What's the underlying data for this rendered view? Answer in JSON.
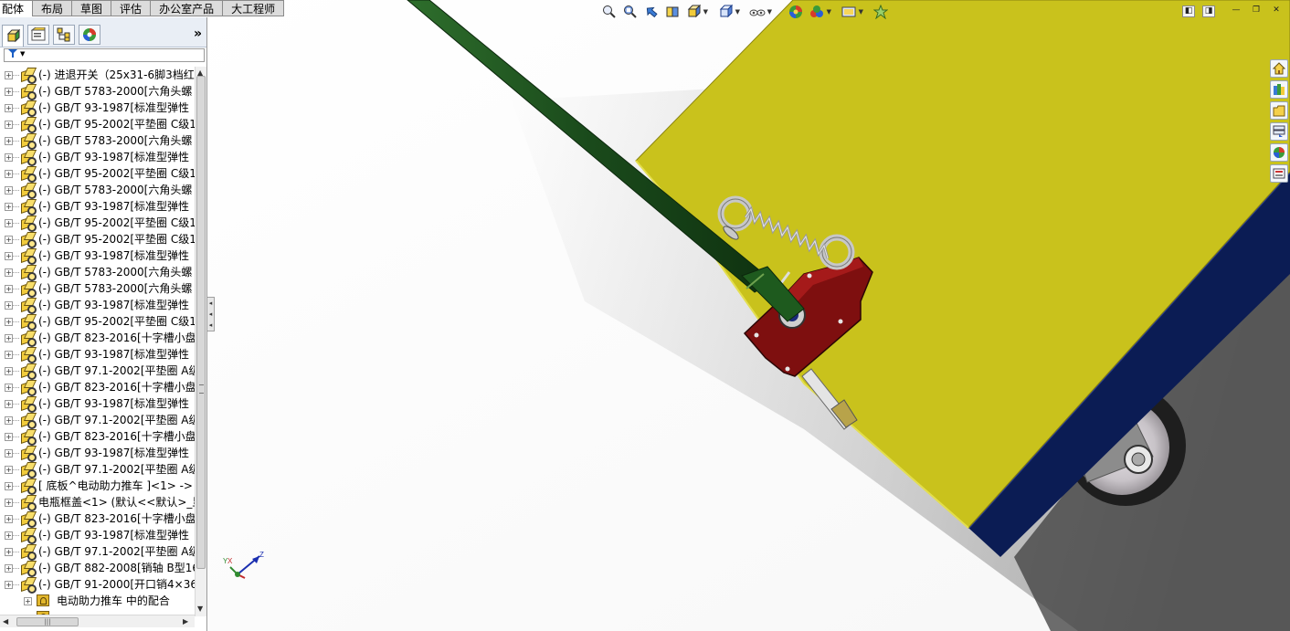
{
  "command_tabs": [
    {
      "label": "配体",
      "active": true
    },
    {
      "label": "布局",
      "active": false
    },
    {
      "label": "草图",
      "active": false
    },
    {
      "label": "评估",
      "active": false
    },
    {
      "label": "办公室产品",
      "active": false
    },
    {
      "label": "大工程师",
      "active": false
    }
  ],
  "panel": {
    "tabs": [
      "feature-manager-icon",
      "property-manager-icon",
      "configuration-manager-icon",
      "display-manager-icon"
    ],
    "expand_glyph": "»",
    "filter_glyph": "▼"
  },
  "tree": {
    "items": [
      "(-) 进退开关（25x31-6脚3档红",
      "(-) GB/T 5783-2000[六角头螺",
      "(-) GB/T 93-1987[标准型弹性",
      "(-) GB/T 95-2002[平垫圈 C级1",
      "(-) GB/T 5783-2000[六角头螺",
      "(-) GB/T 93-1987[标准型弹性",
      "(-) GB/T 95-2002[平垫圈 C级1",
      "(-) GB/T 5783-2000[六角头螺",
      "(-) GB/T 93-1987[标准型弹性",
      "(-) GB/T 95-2002[平垫圈 C级1",
      "(-) GB/T 95-2002[平垫圈 C级1",
      "(-) GB/T 93-1987[标准型弹性",
      "(-) GB/T 5783-2000[六角头螺",
      "(-) GB/T 5783-2000[六角头螺",
      "(-) GB/T 93-1987[标准型弹性",
      "(-) GB/T 95-2002[平垫圈 C级1",
      "(-) GB/T 823-2016[十字槽小盘",
      "(-) GB/T 93-1987[标准型弹性",
      "(-) GB/T 97.1-2002[平垫圈 A级",
      "(-) GB/T 823-2016[十字槽小盘",
      "(-) GB/T 93-1987[标准型弹性",
      "(-) GB/T 97.1-2002[平垫圈 A级",
      "(-) GB/T 823-2016[十字槽小盘",
      "(-) GB/T 93-1987[标准型弹性",
      "(-) GB/T 97.1-2002[平垫圈 A级",
      "[ 底板^电动助力推车 ]<1> ->",
      "电瓶框盖<1> (默认<<默认>_显",
      "(-) GB/T 823-2016[十字槽小盘",
      "(-) GB/T 93-1987[标准型弹性",
      "(-) GB/T 97.1-2002[平垫圈 A级",
      "(-) GB/T 882-2008[销轴 B型16",
      "(-) GB/T 91-2000[开口销4×36"
    ],
    "mates_label": "电动助力推车 中的配合"
  },
  "heads_up_toolbar": [
    "zoom-to-fit-icon",
    "zoom-to-area-icon",
    "previous-view-icon",
    "section-view-icon",
    "view-orientation-icon",
    "display-style-icon",
    "hide-show-items-icon",
    "edit-appearance-icon",
    "apply-scene-icon",
    "view-settings-icon",
    "render-tools-icon"
  ],
  "window_controls": [
    "◧",
    "◨",
    "—",
    "❐",
    "✕"
  ],
  "task_pane": [
    "home-icon",
    "design-library-icon",
    "file-explorer-icon",
    "view-palette-icon",
    "appearances-icon",
    "custom-properties-icon"
  ],
  "triad": {
    "x": "X",
    "y": "Y",
    "z": "Z"
  },
  "colors": {
    "board_yellow": "#c9c21c",
    "frame_navy": "#0b1c54",
    "handle_green": "#1f5520",
    "bracket_red": "#8a1010",
    "panel_bg": "#ffffff",
    "tab_bg": "#dcdcdc"
  }
}
